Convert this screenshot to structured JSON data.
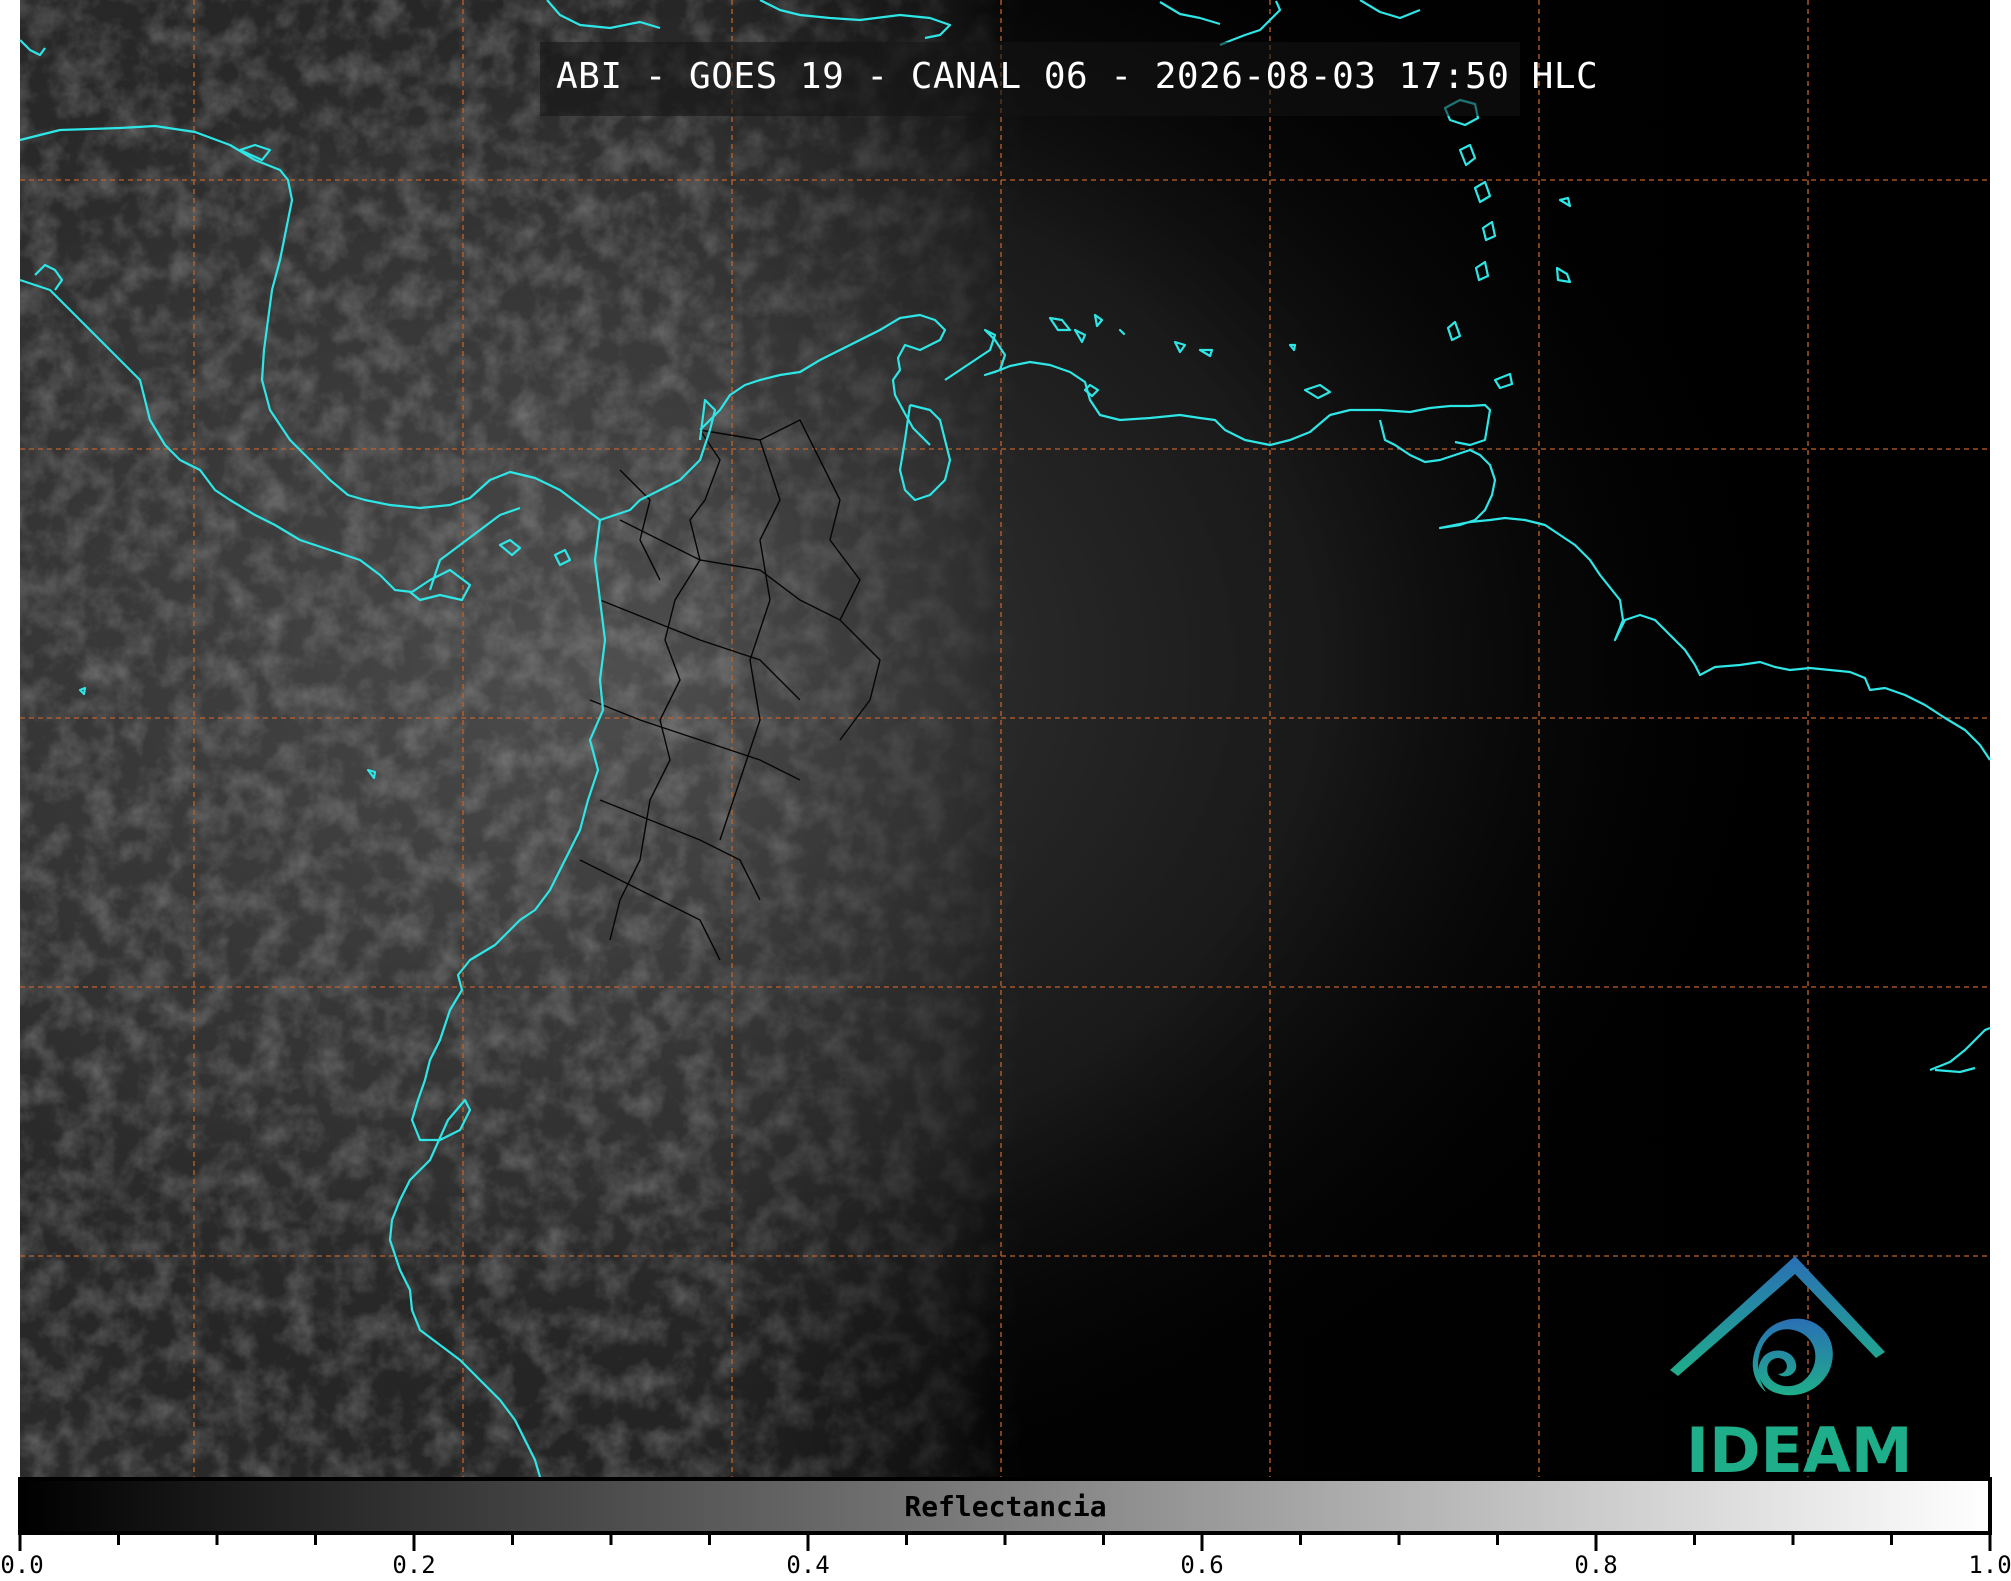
{
  "title": "ABI - GOES 19 - CANAL 06 - 2026-08-03 17:50 HLC",
  "colorbar": {
    "label": "Reflectancia",
    "ticks": [
      "0.0",
      "0.2",
      "0.4",
      "0.6",
      "0.8",
      "1.0"
    ],
    "range": [
      0.0,
      1.0
    ],
    "colormap": "greys (black to white)"
  },
  "map": {
    "projection": "lat-lon",
    "background": "#000000",
    "coastline_color": "#2fe6e6",
    "grid_color": "#c0622a",
    "internal_borders_color": "#000000"
  },
  "logo": {
    "text": "IDEAM",
    "colors": [
      "#2a6fb5",
      "#1fae8a"
    ]
  }
}
